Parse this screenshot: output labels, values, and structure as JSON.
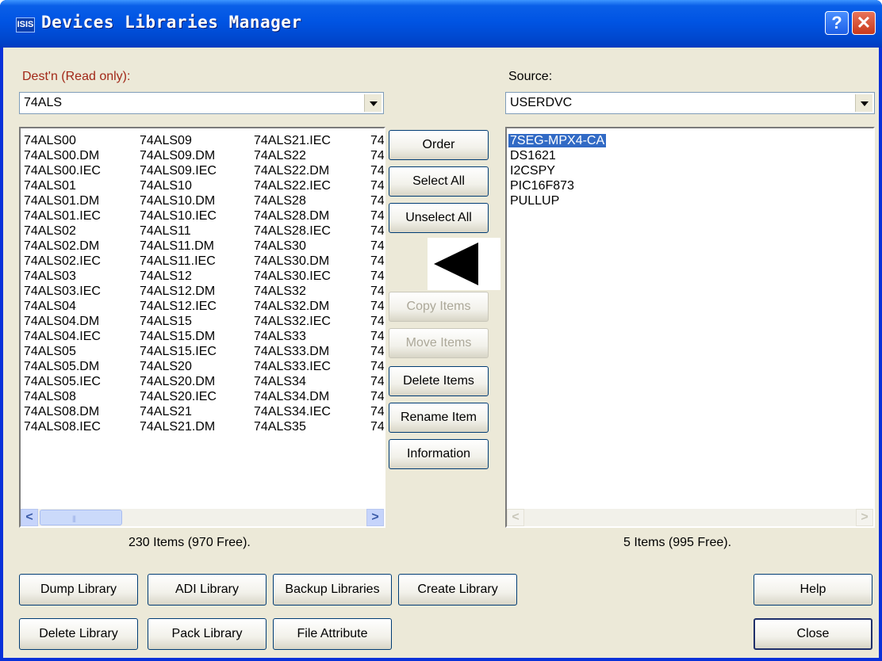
{
  "window": {
    "title": "Devices Libraries Manager",
    "icon_text": "ISIS",
    "help_glyph": "?",
    "close_glyph": "✕"
  },
  "dest": {
    "label": "Dest'n (Read only):",
    "combo_value": "74ALS",
    "columns": [
      [
        "74ALS00",
        "74ALS00.DM",
        "74ALS00.IEC",
        "74ALS01",
        "74ALS01.DM",
        "74ALS01.IEC",
        "74ALS02",
        "74ALS02.DM",
        "74ALS02.IEC",
        "74ALS03",
        "74ALS03.IEC",
        "74ALS04",
        "74ALS04.DM",
        "74ALS04.IEC",
        "74ALS05",
        "74ALS05.DM",
        "74ALS05.IEC",
        "74ALS08",
        "74ALS08.DM",
        "74ALS08.IEC"
      ],
      [
        "74ALS09",
        "74ALS09.DM",
        "74ALS09.IEC",
        "74ALS10",
        "74ALS10.DM",
        "74ALS10.IEC",
        "74ALS11",
        "74ALS11.DM",
        "74ALS11.IEC",
        "74ALS12",
        "74ALS12.DM",
        "74ALS12.IEC",
        "74ALS15",
        "74ALS15.DM",
        "74ALS15.IEC",
        "74ALS20",
        "74ALS20.DM",
        "74ALS20.IEC",
        "74ALS21",
        "74ALS21.DM"
      ],
      [
        "74ALS21.IEC",
        "74ALS22",
        "74ALS22.DM",
        "74ALS22.IEC",
        "74ALS28",
        "74ALS28.DM",
        "74ALS28.IEC",
        "74ALS30",
        "74ALS30.DM",
        "74ALS30.IEC",
        "74ALS32",
        "74ALS32.DM",
        "74ALS32.IEC",
        "74ALS33",
        "74ALS33.DM",
        "74ALS33.IEC",
        "74ALS34",
        "74ALS34.DM",
        "74ALS34.IEC",
        "74ALS35"
      ],
      [
        "74",
        "74",
        "74",
        "74",
        "74",
        "74",
        "74",
        "74",
        "74",
        "74",
        "74",
        "74",
        "74",
        "74",
        "74",
        "74",
        "74",
        "74",
        "74",
        "74"
      ]
    ],
    "status": "230 Items (970 Free)."
  },
  "source": {
    "label": "Source:",
    "combo_value": "USERDVC",
    "items": [
      "7SEG-MPX4-CA",
      "DS1621",
      "I2CSPY",
      "PIC16F873",
      "PULLUP"
    ],
    "selected_index": 0,
    "status": "5 Items (995 Free)."
  },
  "middle_buttons": {
    "order": "Order",
    "select_all": "Select All",
    "unselect_all": "Unselect All",
    "copy_items": "Copy Items",
    "move_items": "Move Items",
    "delete_items": "Delete Items",
    "rename_item": "Rename Item",
    "information": "Information"
  },
  "bottom_buttons": {
    "dump_library": "Dump Library",
    "adi_library": "ADI Library",
    "backup_libraries": "Backup Libraries",
    "create_library": "Create Library",
    "delete_library": "Delete Library",
    "pack_library": "Pack Library",
    "file_attribute": "File Attribute",
    "help": "Help",
    "close": "Close"
  },
  "scroll": {
    "left_glyph": "<",
    "right_glyph": ">"
  },
  "colors": {
    "titlebar": "#0054e3",
    "dialog_bg": "#ece9d8",
    "dest_label": "#a22818",
    "selection": "#316ac5"
  }
}
